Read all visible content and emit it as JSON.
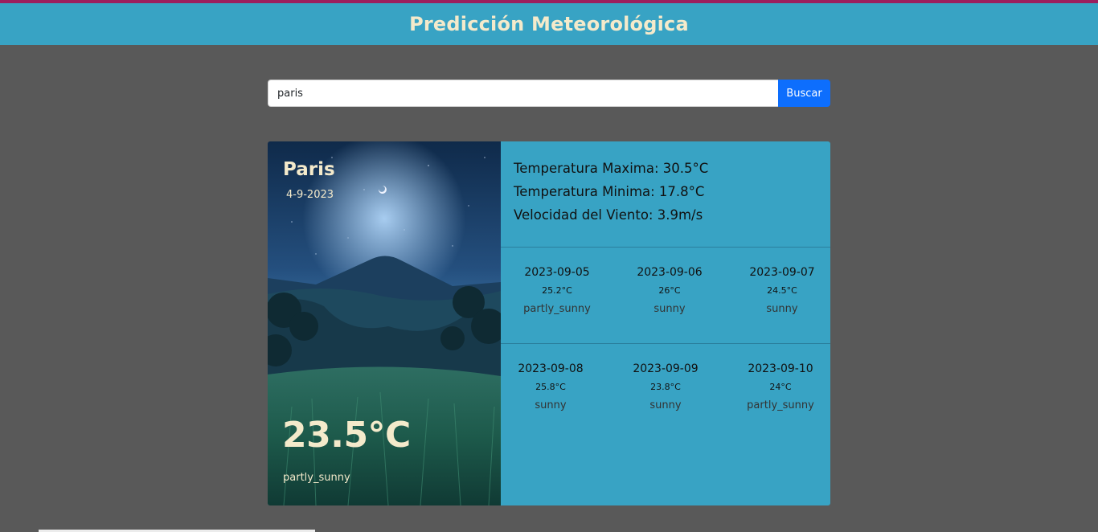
{
  "header": {
    "title": "Predicción Meteorológica"
  },
  "search": {
    "value": "paris",
    "button_label": "Buscar"
  },
  "current": {
    "city": "Paris",
    "date": "4-9-2023",
    "temperature": "23.5°C",
    "condition": "partly_sunny"
  },
  "stats": {
    "max_temp": "Temperatura Maxima: 30.5°C",
    "min_temp": "Temperatura Minima: 17.8°C",
    "wind": "Velocidad del Viento: 3.9m/s"
  },
  "forecast": [
    {
      "date": "2023-09-05",
      "temp": "25.2°C",
      "condition": "partly_sunny"
    },
    {
      "date": "2023-09-06",
      "temp": "26°C",
      "condition": "sunny"
    },
    {
      "date": "2023-09-07",
      "temp": "24.5°C",
      "condition": "sunny"
    },
    {
      "date": "2023-09-08",
      "temp": "25.8°C",
      "condition": "sunny"
    },
    {
      "date": "2023-09-09",
      "temp": "23.8°C",
      "condition": "sunny"
    },
    {
      "date": "2023-09-10",
      "temp": "24°C",
      "condition": "partly_sunny"
    }
  ],
  "colors": {
    "header_bg": "#38a3c4",
    "page_bg": "#595959",
    "accent_text": "#f4eacb",
    "button_bg": "#0d6efd",
    "top_stripe": "#9b1f5e"
  },
  "icons": {
    "background_image": "night-mountain-landscape-image"
  }
}
